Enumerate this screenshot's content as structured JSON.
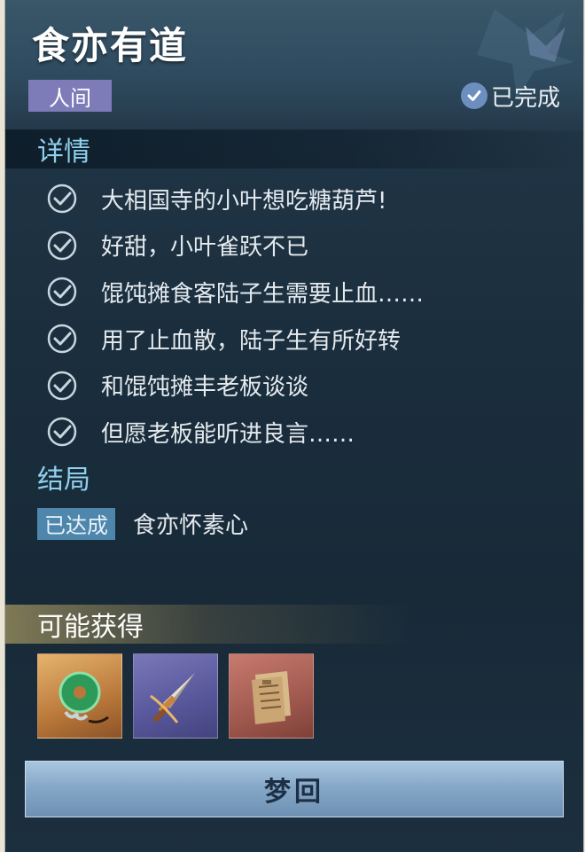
{
  "quest": {
    "title": "食亦有道",
    "category": "人间",
    "status": "已完成"
  },
  "details": {
    "heading": "详情",
    "steps": [
      "大相国寺的小叶想吃糖葫芦!",
      "好甜，小叶雀跃不已",
      "馄饨摊食客陆子生需要止血……",
      "用了止血散，陆子生有所好转",
      "和馄饨摊丰老板谈谈",
      "但愿老板能听进良言……"
    ]
  },
  "ending": {
    "heading": "结局",
    "badge": "已达成",
    "text": "食亦怀素心"
  },
  "rewards": {
    "heading": "可能获得",
    "items": [
      {
        "icon": "jade-pendant-icon",
        "rarity_color": "#d19a55"
      },
      {
        "icon": "dagger-icon",
        "rarity_color": "#6665a8"
      },
      {
        "icon": "book-scroll-icon",
        "rarity_color": "#b0655a"
      }
    ]
  },
  "actions": {
    "dream_label": "梦回"
  },
  "colors": {
    "section_heading": "#8fd0ee",
    "tag_bg": "#7e7cb8",
    "badge_bg": "#4f86ab",
    "panel_bg": "#1a2d3c"
  }
}
